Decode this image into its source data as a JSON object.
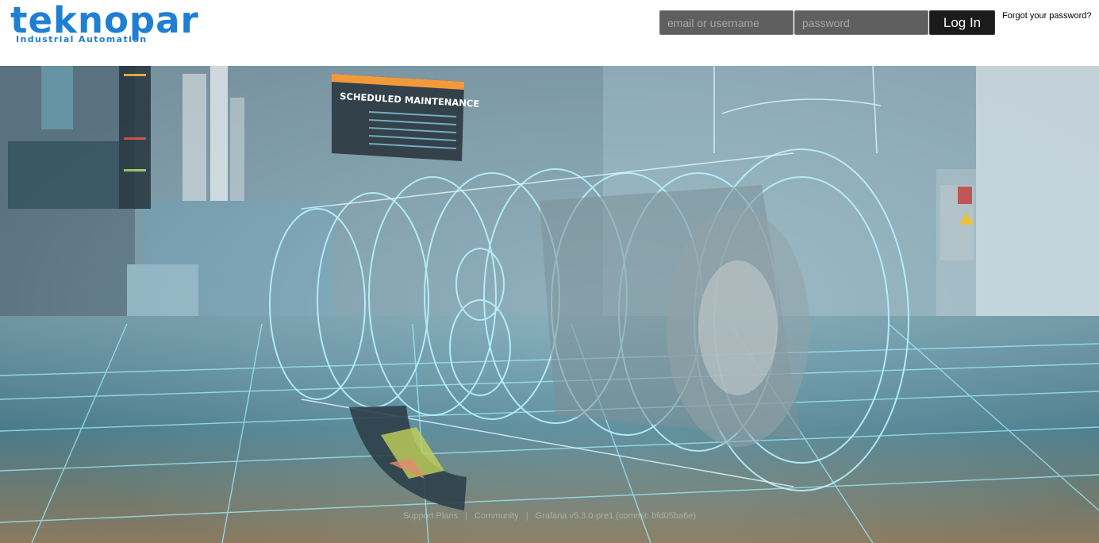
{
  "brand": {
    "name": "teknopar",
    "tagline": "Industrial Automation",
    "color": "#1f7fd3"
  },
  "login": {
    "username_placeholder": "email or username",
    "password_placeholder": "password",
    "submit_label": "Log In",
    "forgot_label": "Forgot your password?"
  },
  "hero": {
    "board_title": "SCHEDULED MAINTENANCE",
    "accent_color": "#7fe6ff"
  },
  "footer": {
    "items": [
      "Support Plans",
      "Community",
      "Grafana v5.3.0-pre1 (commit: bfd05ba6e)"
    ],
    "separator": "|"
  }
}
